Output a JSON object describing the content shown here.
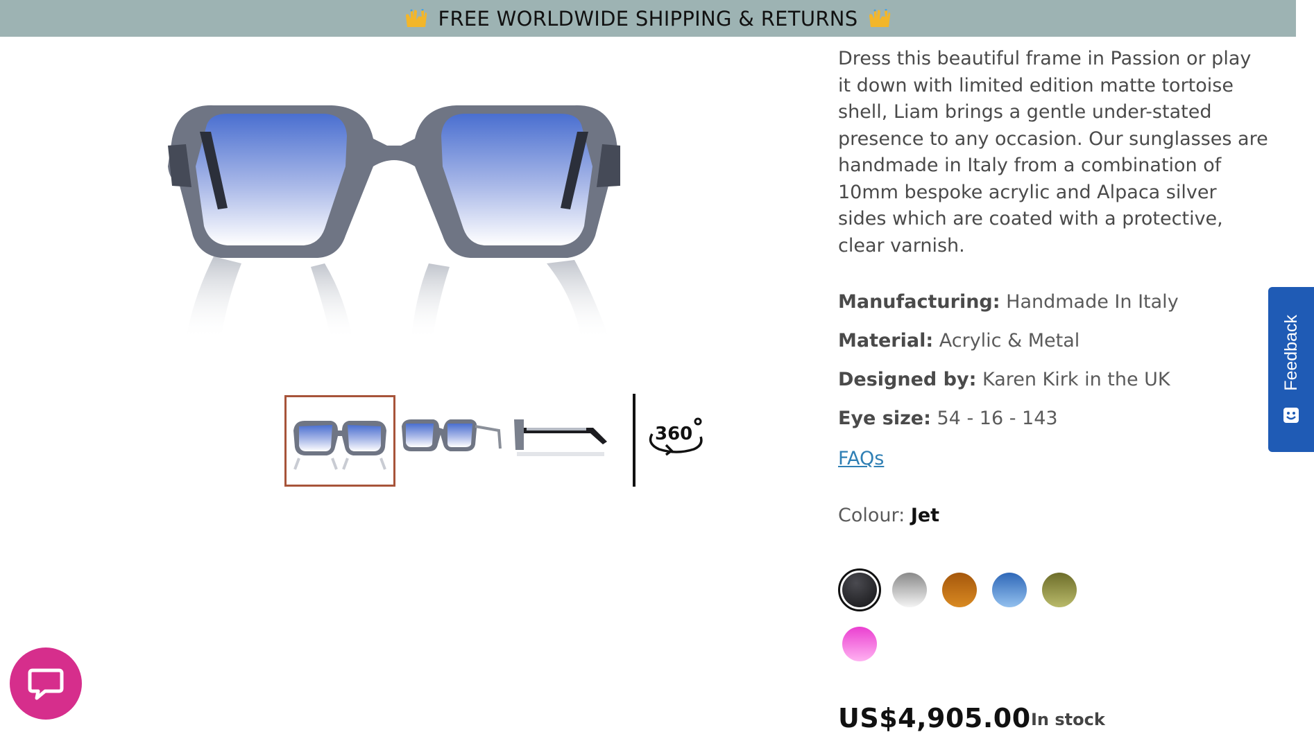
{
  "announcement": {
    "text": "FREE WORLDWIDE SHIPPING & RETURNS",
    "icon": "raising-hands-icon"
  },
  "product": {
    "description": "Dress this beautiful frame in Passion or play it down with limited edition matte tortoise shell, Liam brings a gentle under-stated presence to any occasion. Our sunglasses are handmade in Italy from a combination of 10mm bespoke acrylic and Alpaca silver sides which are coated with a protective, clear varnish.",
    "specs": [
      {
        "label": "Manufacturing:",
        "value": "Handmade In Italy"
      },
      {
        "label": "Material:",
        "value": "Acrylic & Metal"
      },
      {
        "label": "Designed by:",
        "value": "Karen Kirk in the UK"
      },
      {
        "label": "Eye size:",
        "value": "54 - 16 - 143"
      }
    ],
    "faq_link": "FAQs",
    "colour_label": "Colour:",
    "colour_selected": "Jet",
    "swatches": [
      {
        "name": "jet",
        "color": "#1e1e22",
        "selected": true
      },
      {
        "name": "grey-fade",
        "color": "#bdbdbd",
        "selected": false
      },
      {
        "name": "amber",
        "color": "#b4690f",
        "selected": false
      },
      {
        "name": "blue",
        "color": "#3f7cc4",
        "selected": false
      },
      {
        "name": "olive",
        "color": "#8a8a3a",
        "selected": false
      },
      {
        "name": "pink",
        "color": "#f25cd8",
        "selected": false
      }
    ],
    "price": "US$4,905.00",
    "stock": "In stock",
    "thumb_360_label": "360"
  },
  "feedback": {
    "label": "Feedback"
  },
  "colors": {
    "announcement_bg": "#9db3b3",
    "link": "#2f7fb4",
    "feedback_bg": "#1f5bb5",
    "chat_bg": "#d62e8c",
    "thumb_active_border": "#a7543a"
  }
}
